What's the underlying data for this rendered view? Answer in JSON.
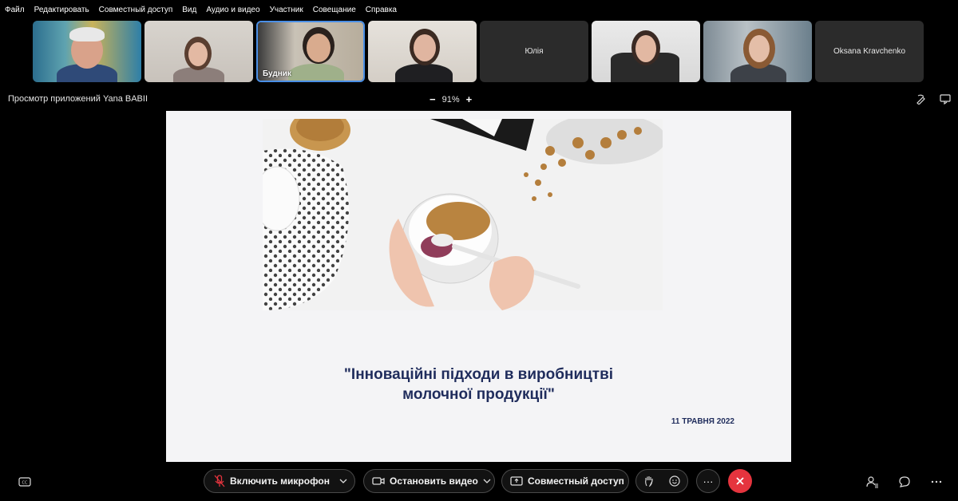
{
  "menu": [
    "Файл",
    "Редактировать",
    "Совместный доступ",
    "Вид",
    "Аудио и видео",
    "Участник",
    "Совещание",
    "Справка"
  ],
  "participants": [
    {
      "name": "",
      "label_visible": false
    },
    {
      "name": "",
      "label_visible": false
    },
    {
      "name": "Будник",
      "label_visible": true,
      "active": true
    },
    {
      "name": "",
      "label_visible": false
    },
    {
      "name": "Юлія",
      "label_visible": true,
      "video": false
    },
    {
      "name": "",
      "label_visible": false
    },
    {
      "name": "",
      "label_visible": false
    },
    {
      "name": "Oksana Kravchenko",
      "label_visible": true,
      "video": false
    }
  ],
  "share": {
    "title": "Просмотр приложений Yana BABII",
    "zoom_minus": "−",
    "zoom_level": "91%",
    "zoom_plus": "+"
  },
  "slide": {
    "title_line1": "\"Інноваційні підходи в виробництві",
    "title_line2": "молочної продукції\"",
    "date": "11 ТРАВНЯ 2022"
  },
  "controls": {
    "mic_label": "Включить микрофон",
    "video_label": "Остановить видео",
    "share_label": "Совместный доступ",
    "more_label": "···"
  },
  "colors": {
    "accent": "#4a8fe6",
    "end_call": "#e5343e",
    "slide_text": "#1f2c5c"
  }
}
